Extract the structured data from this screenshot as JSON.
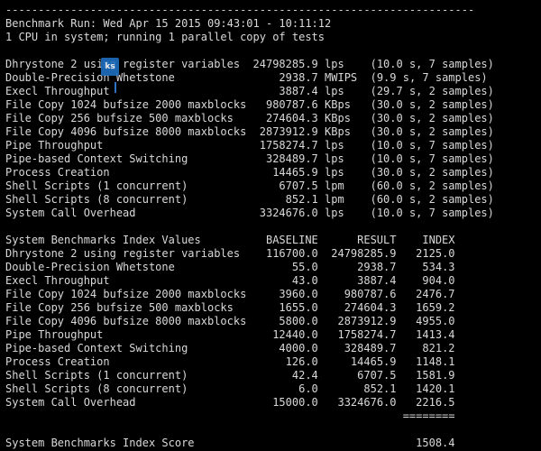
{
  "header": {
    "divider": "------------------------------------------------------------------------",
    "run_line": "Benchmark Run: Wed Apr 15 2015 09:43:01 - 10:11:12",
    "cpu_line": "1 CPU in system; running 1 parallel copy of tests"
  },
  "results": [
    {
      "name": "Dhrystone 2 using register variables",
      "value": "24798285.9",
      "unit": "lps",
      "detail": "(10.0 s, 7 samples)"
    },
    {
      "name": "Double-Precision Whetstone",
      "value": "2938.7",
      "unit": "MWIPS",
      "detail": "(9.9 s, 7 samples)"
    },
    {
      "name": "Execl Throughput",
      "value": "3887.4",
      "unit": "lps",
      "detail": "(29.7 s, 2 samples)"
    },
    {
      "name": "File Copy 1024 bufsize 2000 maxblocks",
      "value": "980787.6",
      "unit": "KBps",
      "detail": "(30.0 s, 2 samples)"
    },
    {
      "name": "File Copy 256 bufsize 500 maxblocks",
      "value": "274604.3",
      "unit": "KBps",
      "detail": "(30.0 s, 2 samples)"
    },
    {
      "name": "File Copy 4096 bufsize 8000 maxblocks",
      "value": "2873912.9",
      "unit": "KBps",
      "detail": "(30.0 s, 2 samples)"
    },
    {
      "name": "Pipe Throughput",
      "value": "1758274.7",
      "unit": "lps",
      "detail": "(10.0 s, 7 samples)"
    },
    {
      "name": "Pipe-based Context Switching",
      "value": "328489.7",
      "unit": "lps",
      "detail": "(10.0 s, 7 samples)"
    },
    {
      "name": "Process Creation",
      "value": "14465.9",
      "unit": "lps",
      "detail": "(30.0 s, 2 samples)"
    },
    {
      "name": "Shell Scripts (1 concurrent)",
      "value": "6707.5",
      "unit": "lpm",
      "detail": "(60.0 s, 2 samples)"
    },
    {
      "name": "Shell Scripts (8 concurrent)",
      "value": "852.1",
      "unit": "lpm",
      "detail": "(60.0 s, 2 samples)"
    },
    {
      "name": "System Call Overhead",
      "value": "3324676.0",
      "unit": "lps",
      "detail": "(10.0 s, 7 samples)"
    }
  ],
  "index_table": {
    "title": "System Benchmarks Index Values",
    "col_baseline": "BASELINE",
    "col_result": "RESULT",
    "col_index": "INDEX",
    "rows": [
      {
        "name": "Dhrystone 2 using register variables",
        "baseline": "116700.0",
        "result": "24798285.9",
        "index": "2125.0"
      },
      {
        "name": "Double-Precision Whetstone",
        "baseline": "55.0",
        "result": "2938.7",
        "index": "534.3"
      },
      {
        "name": "Execl Throughput",
        "baseline": "43.0",
        "result": "3887.4",
        "index": "904.0"
      },
      {
        "name": "File Copy 1024 bufsize 2000 maxblocks",
        "baseline": "3960.0",
        "result": "980787.6",
        "index": "2476.7"
      },
      {
        "name": "File Copy 256 bufsize 500 maxblocks",
        "baseline": "1655.0",
        "result": "274604.3",
        "index": "1659.2"
      },
      {
        "name": "File Copy 4096 bufsize 8000 maxblocks",
        "baseline": "5800.0",
        "result": "2873912.9",
        "index": "4955.0"
      },
      {
        "name": "Pipe Throughput",
        "baseline": "12440.0",
        "result": "1758274.7",
        "index": "1413.4"
      },
      {
        "name": "Pipe-based Context Switching",
        "baseline": "4000.0",
        "result": "328489.7",
        "index": "821.2"
      },
      {
        "name": "Process Creation",
        "baseline": "126.0",
        "result": "14465.9",
        "index": "1148.1"
      },
      {
        "name": "Shell Scripts (1 concurrent)",
        "baseline": "42.4",
        "result": "6707.5",
        "index": "1581.9"
      },
      {
        "name": "Shell Scripts (8 concurrent)",
        "baseline": "6.0",
        "result": "852.1",
        "index": "1420.1"
      },
      {
        "name": "System Call Overhead",
        "baseline": "15000.0",
        "result": "3324676.0",
        "index": "2216.5"
      }
    ],
    "separator": "========",
    "score_label": "System Benchmarks Index Score",
    "score_value": "1508.4"
  },
  "watermark": {
    "text": "ks"
  }
}
